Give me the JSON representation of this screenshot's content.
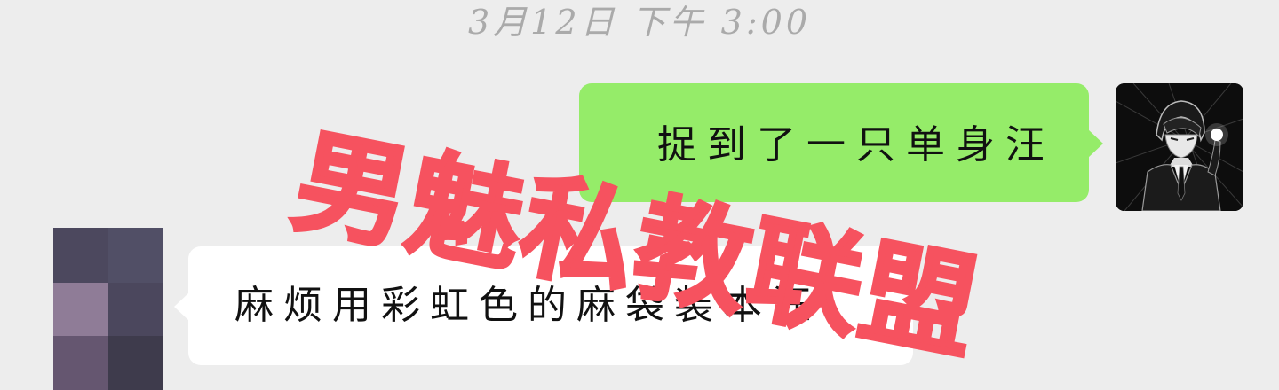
{
  "chat": {
    "timestamp": "3月12日 下午 3:00",
    "messages": [
      {
        "from": "self",
        "text": "捉到了一只单身汪",
        "bubble_color": "#95ec69",
        "avatar": "anime-boy-suit-avatar"
      },
      {
        "from": "other",
        "text": "麻烦用彩虹色的麻袋装本汪",
        "bubble_color": "#ffffff",
        "avatar": "pixelated-avatar"
      }
    ]
  },
  "watermark": {
    "text": "男魅私教联盟",
    "color": "#f6525f"
  },
  "colors": {
    "background": "#ededed",
    "timestamp": "#aaaaaa"
  }
}
